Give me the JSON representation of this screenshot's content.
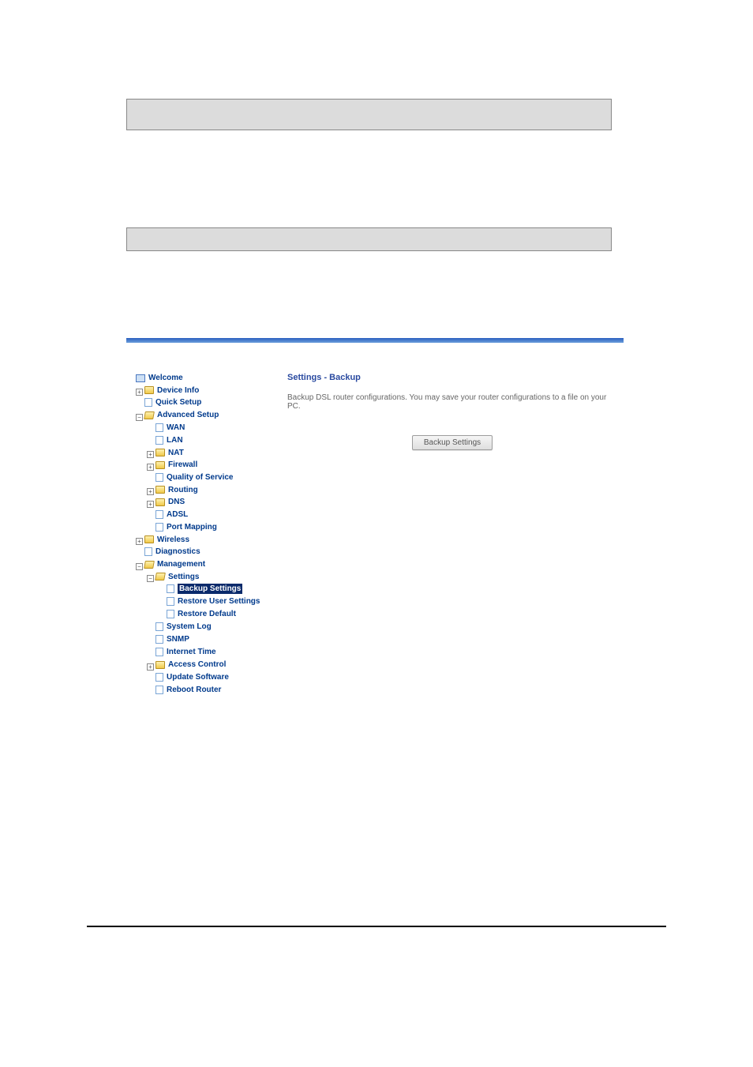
{
  "tree": {
    "welcome": "Welcome",
    "device_info": "Device Info",
    "quick_setup": "Quick Setup",
    "advanced_setup": "Advanced Setup",
    "wan": "WAN",
    "lan": "LAN",
    "nat": "NAT",
    "firewall": "Firewall",
    "qos": "Quality of Service",
    "routing": "Routing",
    "dns": "DNS",
    "adsl": "ADSL",
    "port_mapping": "Port Mapping",
    "wireless": "Wireless",
    "diagnostics": "Diagnostics",
    "management": "Management",
    "settings": "Settings",
    "backup_settings": "Backup Settings",
    "restore_user_settings": "Restore User Settings",
    "restore_default": "Restore Default",
    "system_log": "System Log",
    "snmp": "SNMP",
    "internet_time": "Internet Time",
    "access_control": "Access Control",
    "update_software": "Update Software",
    "reboot_router": "Reboot Router"
  },
  "main": {
    "title": "Settings - Backup",
    "description": "Backup DSL router configurations. You may save your router configurations to a file on your PC.",
    "button": "Backup Settings"
  },
  "expanders": {
    "plus": "+",
    "minus": "−"
  }
}
